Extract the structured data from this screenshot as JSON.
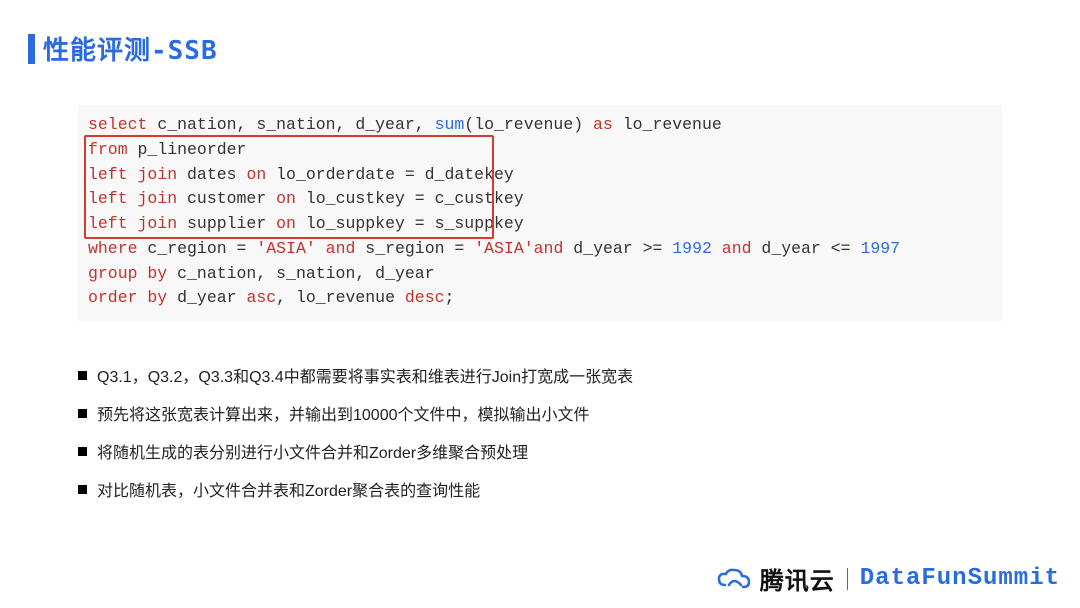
{
  "title": "性能评测-SSB",
  "sql": {
    "l1": {
      "p1": "select",
      "p2": " c_nation, s_nation, d_year, ",
      "p3": "sum",
      "p4": "(lo_revenue) ",
      "p5": "as",
      "p6": " lo_revenue"
    },
    "l2": {
      "p1": "from",
      "p2": " p_lineorder"
    },
    "l3": {
      "p1": "left join",
      "p2": " dates ",
      "p3": "on",
      "p4": " lo_orderdate = d_datekey"
    },
    "l4": {
      "p1": "left join",
      "p2": " customer ",
      "p3": "on",
      "p4": " lo_custkey = c_custkey"
    },
    "l5": {
      "p1": "left join",
      "p2": " supplier ",
      "p3": "on",
      "p4": " lo_suppkey = s_suppkey"
    },
    "l6": {
      "p1": "where",
      "p2": " c_region = ",
      "p3": "'ASIA'",
      "p4": " ",
      "p5": "and",
      "p6": " s_region = ",
      "p7": "'ASIA'",
      "p8": "and",
      "p9": " d_year >= ",
      "p10": "1992",
      "p11": " ",
      "p12": "and",
      "p13": " d_year <= ",
      "p14": "1997"
    },
    "l7": {
      "p1": "group by",
      "p2": " c_nation, s_nation, d_year"
    },
    "l8": {
      "p1": "order by",
      "p2": " d_year ",
      "p3": "asc",
      "p4": ", lo_revenue ",
      "p5": "desc",
      "p6": ";"
    }
  },
  "bullets": [
    "Q3.1，Q3.2，Q3.3和Q3.4中都需要将事实表和维表进行Join打宽成一张宽表",
    "预先将这张宽表计算出来，并输出到10000个文件中，模拟输出小文件",
    "将随机生成的表分别进行小文件合并和Zorder多维聚合预处理",
    "对比随机表，小文件合并表和Zorder聚合表的查询性能"
  ],
  "footer": {
    "tencent": "腾讯云",
    "datafun": "DataFunSummit"
  }
}
